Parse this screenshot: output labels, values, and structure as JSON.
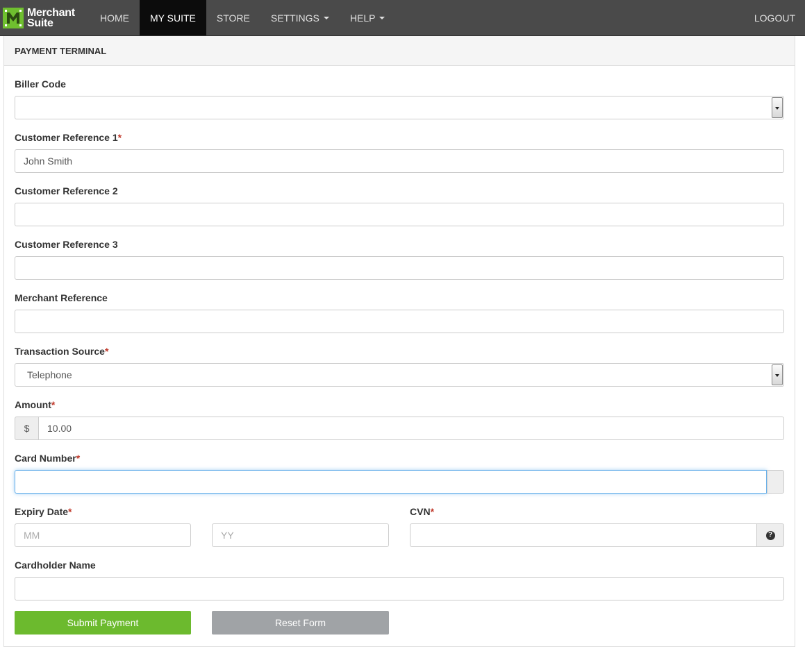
{
  "nav": {
    "brand_line1": "Merchant",
    "brand_line2": "Suite",
    "items": [
      {
        "label": "HOME"
      },
      {
        "label": "MY SUITE"
      },
      {
        "label": "STORE"
      },
      {
        "label": "SETTINGS"
      },
      {
        "label": "HELP"
      }
    ],
    "logout": "LOGOUT"
  },
  "panel": {
    "title": "PAYMENT TERMINAL"
  },
  "form": {
    "biller_code": {
      "label": "Biller Code",
      "value": ""
    },
    "cust_ref1": {
      "label": "Customer Reference 1",
      "required": "*",
      "value": "John Smith"
    },
    "cust_ref2": {
      "label": "Customer Reference 2",
      "value": ""
    },
    "cust_ref3": {
      "label": "Customer Reference 3",
      "value": ""
    },
    "merchant_ref": {
      "label": "Merchant Reference",
      "value": ""
    },
    "txn_source": {
      "label": "Transaction Source",
      "required": "*",
      "value": "Telephone"
    },
    "amount": {
      "label": "Amount",
      "required": "*",
      "currency": "$",
      "value": "10.00"
    },
    "card_number": {
      "label": "Card Number",
      "required": "*",
      "value": ""
    },
    "expiry": {
      "label": "Expiry Date",
      "required": "*",
      "month_placeholder": "MM",
      "year_placeholder": "YY"
    },
    "cvn": {
      "label": "CVN",
      "required": "*",
      "help_icon": "?"
    },
    "cardholder": {
      "label": "Cardholder Name",
      "value": ""
    },
    "submit_label": "Submit Payment",
    "reset_label": "Reset Form"
  },
  "colors": {
    "navbar": "#4a4a4a",
    "nav_active": "#0c0c0c",
    "brand_green": "#6fbf2f",
    "submit": "#6cba2e",
    "reset": "#a0a3a6",
    "required": "#c0392b"
  }
}
